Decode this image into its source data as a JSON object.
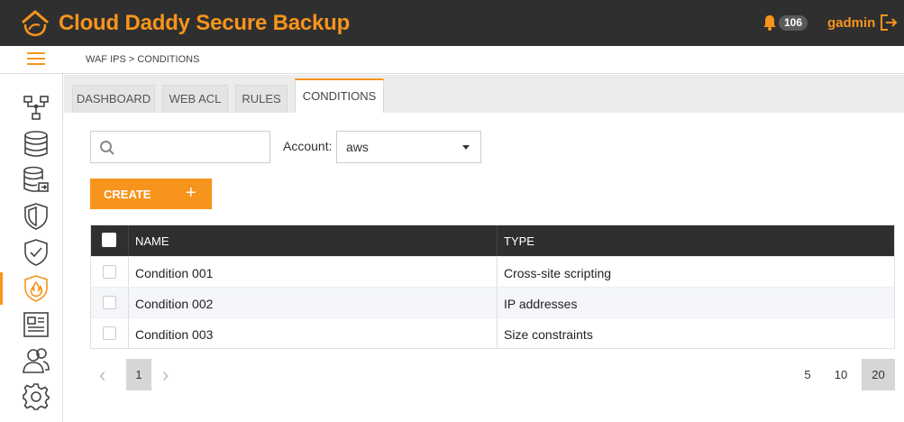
{
  "header": {
    "app_title": "Cloud Daddy Secure Backup",
    "notification_count": "106",
    "username": "gadmin",
    "brand_color": "#f7941d"
  },
  "breadcrumb": "WAF IPS > CONDITIONS",
  "sidebar": {
    "items": [
      {
        "icon": "network-icon",
        "active": false
      },
      {
        "icon": "database-icon",
        "active": false
      },
      {
        "icon": "database-export-icon",
        "active": false
      },
      {
        "icon": "shield-icon",
        "active": false
      },
      {
        "icon": "shield-check-icon",
        "active": false
      },
      {
        "icon": "shield-fire-icon",
        "active": true
      },
      {
        "icon": "report-icon",
        "active": false
      },
      {
        "icon": "users-icon",
        "active": false
      },
      {
        "icon": "settings-icon",
        "active": false
      }
    ]
  },
  "tabs": [
    {
      "label": "DASHBOARD",
      "active": false
    },
    {
      "label": "WEB ACL",
      "active": false
    },
    {
      "label": "RULES",
      "active": false
    },
    {
      "label": "CONDITIONS",
      "active": true
    }
  ],
  "filters": {
    "search_value": "",
    "account_label": "Account:",
    "account_value": "aws"
  },
  "create_label": "CREATE",
  "table": {
    "columns": [
      "NAME",
      "TYPE"
    ],
    "rows": [
      {
        "name": "Condition 001",
        "type": "Cross-site scripting"
      },
      {
        "name": "Condition 002",
        "type": "IP addresses"
      },
      {
        "name": "Condition 003",
        "type": "Size constraints"
      }
    ]
  },
  "pagination": {
    "current_page": "1",
    "page_sizes": [
      "5",
      "10",
      "20"
    ],
    "selected_size": "20"
  }
}
